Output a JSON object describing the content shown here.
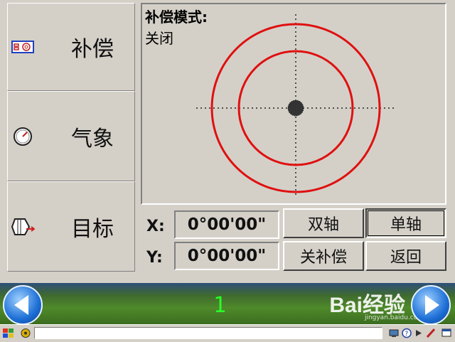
{
  "sidebar": {
    "items": [
      {
        "label": "补偿",
        "icon": "compensation-icon"
      },
      {
        "label": "气象",
        "icon": "gauge-icon"
      },
      {
        "label": "目标",
        "icon": "target-prism-icon"
      }
    ]
  },
  "panel": {
    "mode_title": "补偿模式:",
    "mode_value": "关闭"
  },
  "coords": {
    "x_label": "X:",
    "x_value": "0°00'00\"",
    "y_label": "Y:",
    "y_value": "0°00'00\""
  },
  "buttons": {
    "dual_axis": "双轴",
    "single_axis": "单轴",
    "comp_off": "关补偿",
    "back": "返回"
  },
  "footer": {
    "page_number": "1",
    "watermark": "Bai经验",
    "watermark_sub": "jingyan.baidu.com"
  },
  "colors": {
    "ring": "#e01010",
    "page_number": "#28ff28"
  }
}
